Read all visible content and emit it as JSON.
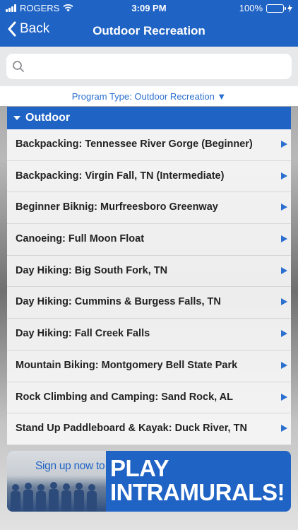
{
  "status_bar": {
    "carrier": "ROGERS",
    "time": "3:09 PM",
    "battery": "100%",
    "battery_level": 1.0
  },
  "nav": {
    "back_label": "Back",
    "title": "Outdoor Recreation"
  },
  "search": {
    "placeholder": "",
    "value": ""
  },
  "filter": {
    "label": "Program Type: Outdoor Recreation ▼"
  },
  "section": {
    "label": "Outdoor"
  },
  "items": [
    {
      "label": "Backpacking: Tennessee River Gorge (Beginner)"
    },
    {
      "label": "Backpacking: Virgin Fall, TN (Intermediate)"
    },
    {
      "label": "Beginner Biknig: Murfreesboro Greenway"
    },
    {
      "label": "Canoeing: Full Moon Float"
    },
    {
      "label": "Day Hiking: Big South Fork, TN"
    },
    {
      "label": "Day Hiking: Cummins & Burgess Falls, TN"
    },
    {
      "label": "Day Hiking: Fall Creek Falls"
    },
    {
      "label": "Mountain Biking: Montgomery Bell State Park"
    },
    {
      "label": "Rock Climbing and Camping: Sand Rock, AL"
    },
    {
      "label": "Stand Up Paddleboard & Kayak: Duck River, TN"
    }
  ],
  "banner": {
    "subtitle": "Sign up now to",
    "line1": "PLAY",
    "line2": "INTRAMURALS!"
  },
  "colors": {
    "accent": "#1f63c5",
    "link": "#2b6fcf",
    "battery": "#5fd35f"
  }
}
